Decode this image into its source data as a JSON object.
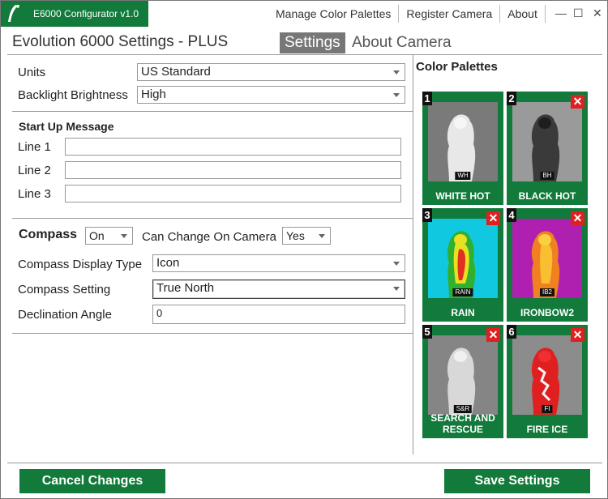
{
  "titlebar": {
    "app_name": "E6000 Configurator v1.0",
    "menu": [
      "Manage Color Palettes",
      "Register Camera",
      "About"
    ],
    "minimize": "—",
    "maximize": "☐",
    "close": "✕"
  },
  "header": {
    "title": "Evolution 6000 Settings - PLUS",
    "tabs": [
      {
        "label": "Settings",
        "active": true
      },
      {
        "label": "About Camera",
        "active": false
      }
    ]
  },
  "settings": {
    "units": {
      "label": "Units",
      "value": "US Standard"
    },
    "backlight": {
      "label": "Backlight Brightness",
      "value": "High"
    },
    "startup": {
      "heading": "Start Up Message",
      "lines": [
        {
          "label": "Line 1",
          "value": ""
        },
        {
          "label": "Line 2",
          "value": ""
        },
        {
          "label": "Line 3",
          "value": ""
        }
      ]
    },
    "compass": {
      "label": "Compass",
      "value": "On",
      "can_change_label": "Can Change On Camera",
      "can_change_value": "Yes",
      "display_type_label": "Compass Display Type",
      "display_type_value": "Icon",
      "setting_label": "Compass Setting",
      "setting_value": "True North",
      "declination_label": "Declination Angle",
      "declination_value": "0"
    }
  },
  "palettes": {
    "heading": "Color Palettes",
    "items": [
      {
        "num": "1",
        "tag": "WH",
        "name": "WHITE HOT",
        "deletable": false
      },
      {
        "num": "2",
        "tag": "BH",
        "name": "BLACK HOT",
        "deletable": true
      },
      {
        "num": "3",
        "tag": "RAIN",
        "name": "RAIN",
        "deletable": true
      },
      {
        "num": "4",
        "tag": "IB2",
        "name": "IRONBOW2",
        "deletable": true
      },
      {
        "num": "5",
        "tag": "S&R",
        "name": "SEARCH AND RESCUE",
        "deletable": true
      },
      {
        "num": "6",
        "tag": "FI",
        "name": "FIRE ICE",
        "deletable": true
      }
    ],
    "delete_glyph": "✕"
  },
  "footer": {
    "cancel_label": "Cancel Changes",
    "save_label": "Save Settings"
  },
  "colors": {
    "brand_green": "#127a3a",
    "delete_red": "#e02020",
    "active_tab": "#777777"
  }
}
